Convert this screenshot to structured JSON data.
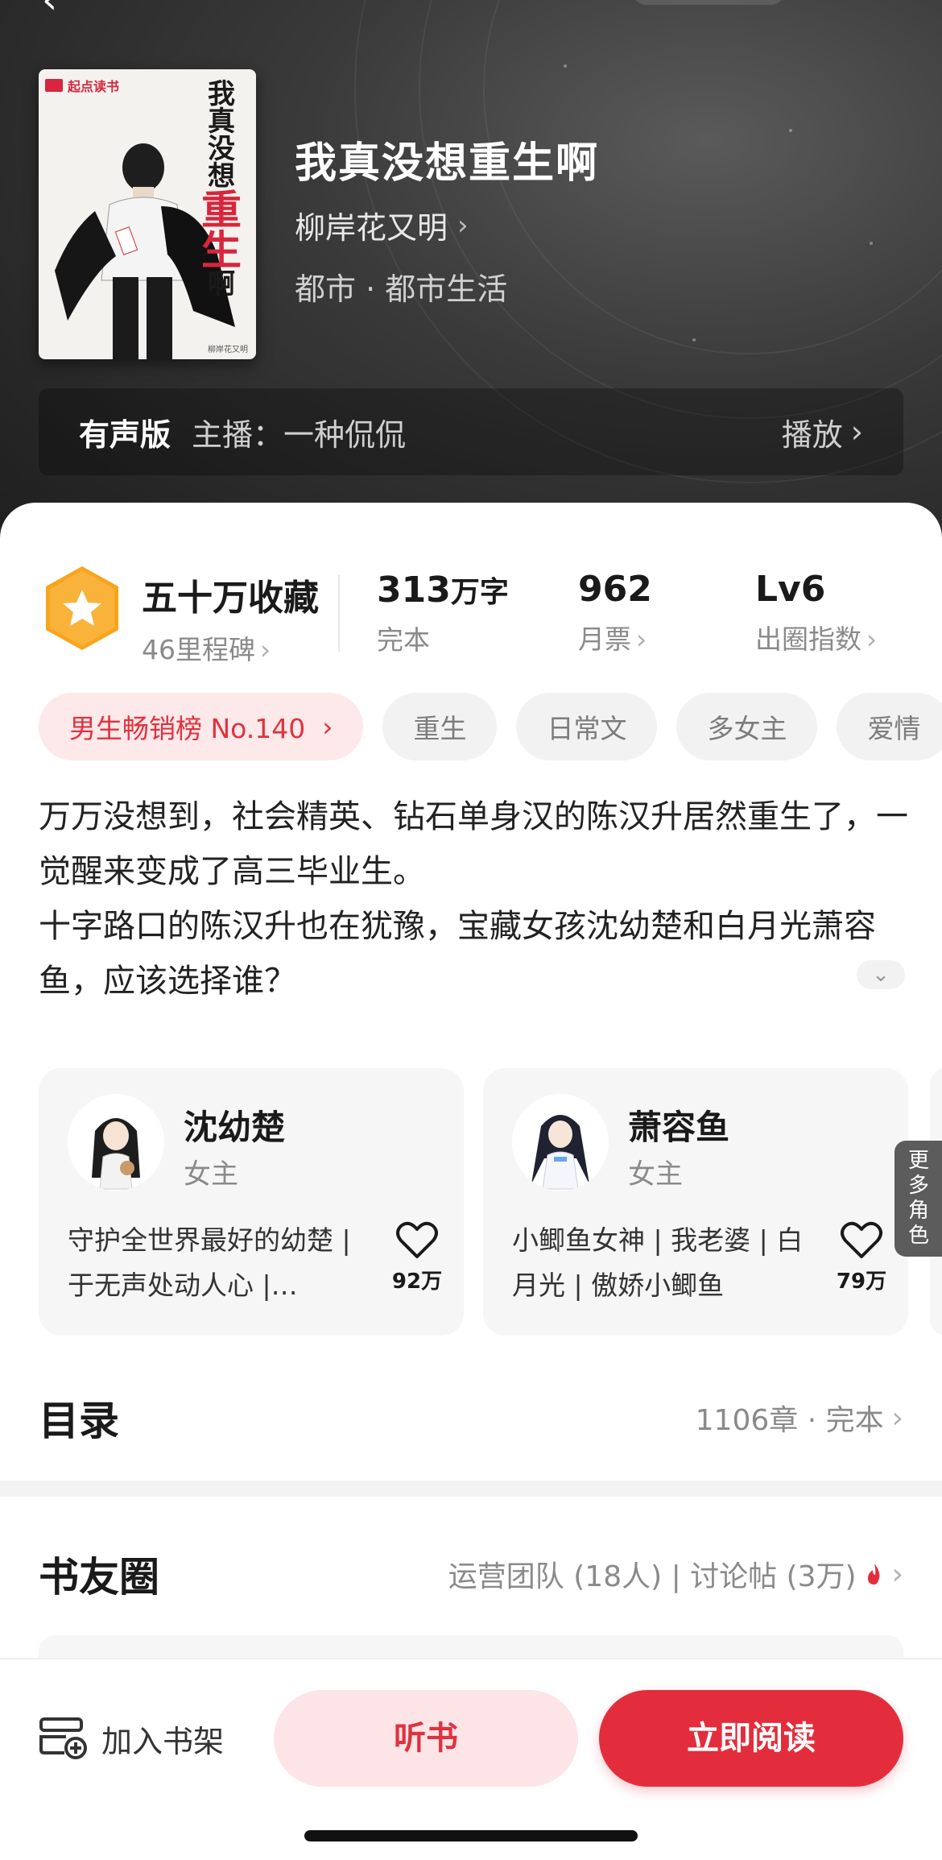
{
  "book": {
    "title": "我真没想重生啊",
    "author": "柳岸花又明",
    "genre": "都市 · 都市生活",
    "cover": {
      "brand": "起点读书",
      "title_chars": [
        "我",
        "真",
        "没",
        "想",
        "重",
        "生",
        "啊"
      ],
      "author": "柳岸花又明"
    }
  },
  "audio": {
    "label": "有声版",
    "host": "主播：一种侃侃",
    "play": "播放"
  },
  "stats": {
    "collect": {
      "value": "五十万收藏",
      "label": "46里程碑"
    },
    "words": {
      "value": "313",
      "unit": "万字",
      "label": "完本"
    },
    "tickets": {
      "value": "962",
      "label": "月票"
    },
    "level": {
      "value": "Lv6",
      "label": "出圈指数"
    }
  },
  "tags": [
    "男生畅销榜 No.140",
    "重生",
    "日常文",
    "多女主",
    "爱情"
  ],
  "description": [
    "万万没想到，社会精英、钻石单身汉的陈汉升居然重生了，一觉醒来变成了高三毕业生。",
    "十字路口的陈汉升也在犹豫，宝藏女孩沈幼楚和白月光萧容鱼，应该选择谁？"
  ],
  "roles": [
    {
      "name": "沈幼楚",
      "role": "女主",
      "bio": "守护全世界最好的幼楚 | 于无声处动人心 |…",
      "likes": "92万"
    },
    {
      "name": "萧容鱼",
      "role": "女主",
      "bio": "小鲫鱼女神 | 我老婆 | 白月光 | 傲娇小鲫鱼",
      "likes": "79万"
    }
  ],
  "more_roles": [
    "更",
    "多",
    "角",
    "色"
  ],
  "catalog": {
    "title": "目录",
    "meta": "1106章 · 完本"
  },
  "community": {
    "title": "书友圈",
    "meta": "运营团队 (18人) | 讨论帖 (3万)"
  },
  "bottom": {
    "shelf": "加入书架",
    "listen": "听书",
    "read": "立即阅读"
  },
  "colors": {
    "accent": "#e42d3c",
    "badge": "#f7a51e",
    "hero_bg": "#2e2e2e"
  }
}
